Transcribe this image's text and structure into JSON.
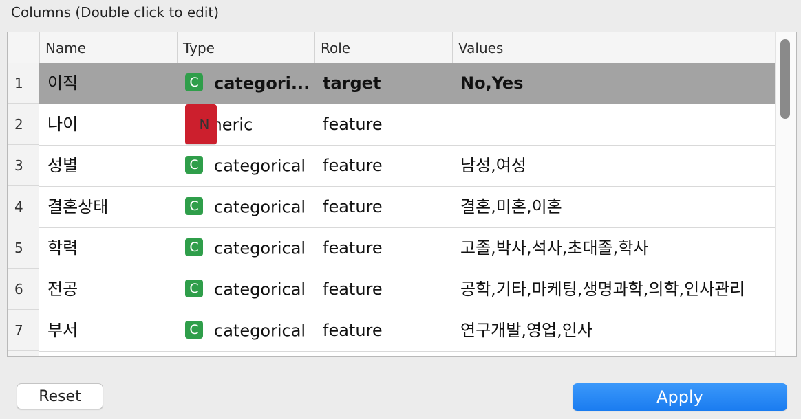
{
  "section": {
    "title": "Columns (Double click to edit)"
  },
  "table": {
    "headers": {
      "name": "Name",
      "type": "Type",
      "role": "Role",
      "values": "Values"
    },
    "rows": [
      {
        "num": "1",
        "name": "이직",
        "type_badge": "C",
        "type": "categori...",
        "role": "target",
        "values": "No,Yes",
        "selected": true
      },
      {
        "num": "2",
        "name": "나이",
        "type_badge": "N",
        "type": "numeric",
        "role": "feature",
        "values": ""
      },
      {
        "num": "3",
        "name": "성별",
        "type_badge": "C",
        "type": "categorical",
        "role": "feature",
        "values": "남성,여성"
      },
      {
        "num": "4",
        "name": "결혼상태",
        "type_badge": "C",
        "type": "categorical",
        "role": "feature",
        "values": "결혼,미혼,이혼"
      },
      {
        "num": "5",
        "name": "학력",
        "type_badge": "C",
        "type": "categorical",
        "role": "feature",
        "values": "고졸,박사,석사,초대졸,학사"
      },
      {
        "num": "6",
        "name": "전공",
        "type_badge": "C",
        "type": "categorical",
        "role": "feature",
        "values": "공학,기타,마케팅,생명과학,의학,인사관리"
      },
      {
        "num": "7",
        "name": "부서",
        "type_badge": "C",
        "type": "categorical",
        "role": "feature",
        "values": "연구개발,영업,인사"
      }
    ]
  },
  "buttons": {
    "reset": "Reset",
    "apply": "Apply"
  },
  "colors": {
    "categorical_badge": "#2f9e4a",
    "numeric_badge": "#cc1f2d",
    "accent": "#1a7cf0",
    "selected_row": "#a3a3a3"
  }
}
